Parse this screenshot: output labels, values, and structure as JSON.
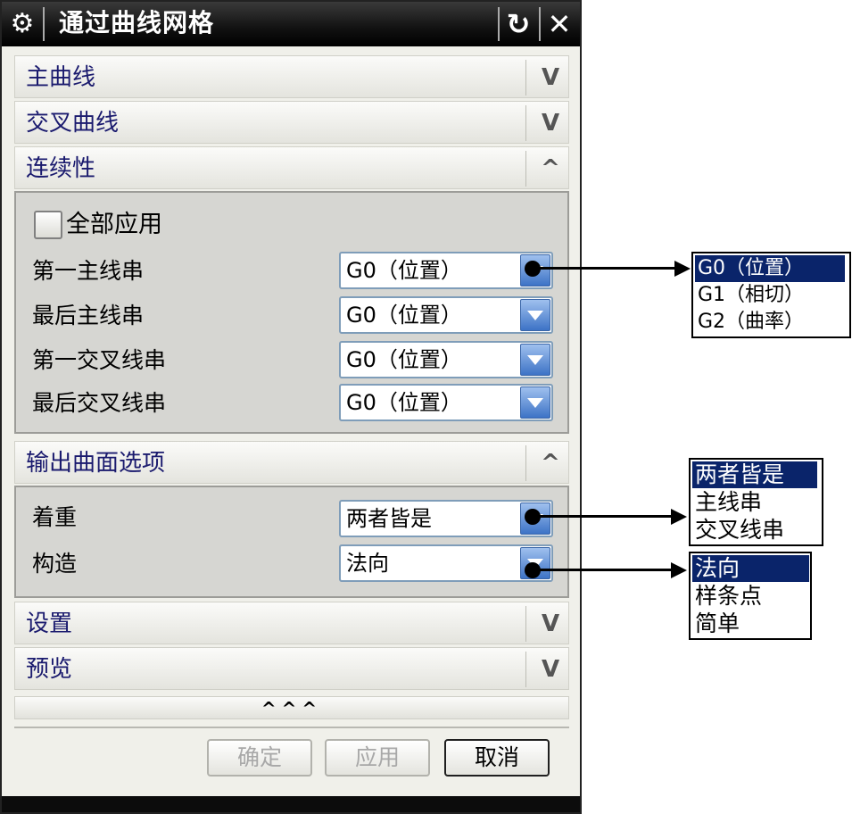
{
  "dialog": {
    "title": "通过曲线网格"
  },
  "sections": {
    "primary": {
      "label": "主曲线",
      "chevron": "V"
    },
    "cross": {
      "label": "交叉曲线",
      "chevron": "V"
    },
    "continuity": {
      "label": "连续性",
      "chevron": "^"
    },
    "output": {
      "label": "输出曲面选项",
      "chevron": "^"
    },
    "settings": {
      "label": "设置",
      "chevron": "V"
    },
    "preview": {
      "label": "预览",
      "chevron": "V"
    }
  },
  "continuity": {
    "apply_all_label": "全部应用",
    "rows": [
      {
        "label": "第一主线串",
        "value": "G0（位置）"
      },
      {
        "label": "最后主线串",
        "value": "G0（位置）"
      },
      {
        "label": "第一交叉线串",
        "value": "G0（位置）"
      },
      {
        "label": "最后交叉线串",
        "value": "G0（位置）"
      }
    ]
  },
  "output": {
    "rows": [
      {
        "label": "着重",
        "value": "两者皆是"
      },
      {
        "label": "构造",
        "value": "法向"
      }
    ]
  },
  "more_label": "^^^",
  "buttons": {
    "ok": "确定",
    "apply": "应用",
    "cancel": "取消"
  },
  "callouts": {
    "continuity_options": [
      "G0（位置）",
      "G1（相切）",
      "G2（曲率）"
    ],
    "emphasis_options": [
      "两者皆是",
      "主线串",
      "交叉线串"
    ],
    "construction_options": [
      "法向",
      "样条点",
      "简单"
    ]
  },
  "colors": {
    "title_bar": "#111111",
    "section_label": "#1a1a6e",
    "selected_option": "#0a246a",
    "combo_button": "#3d73c6"
  },
  "icons": {
    "title_left": "gear-icon",
    "reset": "reset-icon",
    "close": "close-icon"
  }
}
